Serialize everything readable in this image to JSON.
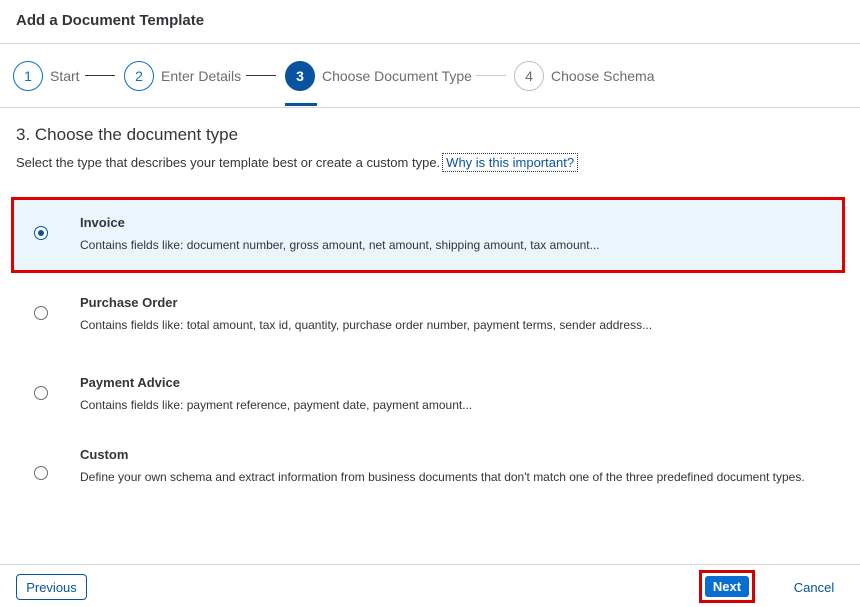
{
  "dialog": {
    "title": "Add a Document Template"
  },
  "wizard": {
    "steps": [
      {
        "number": "1",
        "label": "Start",
        "state": "done"
      },
      {
        "number": "2",
        "label": "Enter Details",
        "state": "done"
      },
      {
        "number": "3",
        "label": "Choose Document Type",
        "state": "active"
      },
      {
        "number": "4",
        "label": "Choose Schema",
        "state": "future"
      }
    ]
  },
  "content": {
    "heading": "3. Choose the document type",
    "description": "Select the type that describes your template best or create a custom type.",
    "help_link": "Why is this important?",
    "options": [
      {
        "title": "Invoice",
        "description": "Contains fields like: document number, gross amount, net amount, shipping amount, tax amount...",
        "selected": true
      },
      {
        "title": "Purchase Order",
        "description": "Contains fields like: total amount, tax id, quantity, purchase order number, payment terms, sender address...",
        "selected": false
      },
      {
        "title": "Payment Advice",
        "description": "Contains fields like: payment reference, payment date, payment amount...",
        "selected": false
      },
      {
        "title": "Custom",
        "description": "Define your own schema and extract information from business documents that don't match one of the three predefined document types.",
        "selected": false
      }
    ]
  },
  "footer": {
    "previous_label": "Previous",
    "next_label": "Next",
    "cancel_label": "Cancel"
  },
  "colors": {
    "accent": "#0854a0",
    "highlight_border": "#e00000",
    "selected_bg": "#ebf5fe"
  }
}
